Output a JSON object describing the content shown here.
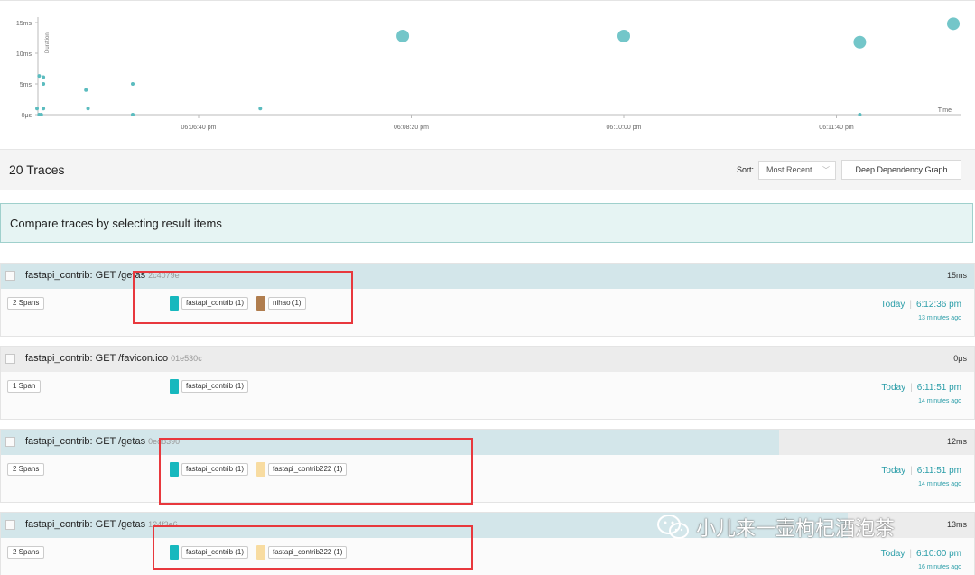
{
  "chart_data": {
    "type": "scatter",
    "y_ticks": [
      "15ms",
      "10ms",
      "5ms",
      "0μs"
    ],
    "y_tick_values": [
      15,
      10,
      5,
      0
    ],
    "ylabel": "Duration",
    "xlabel": "Time",
    "x_ticks": [
      "06:06:40 pm",
      "06:08:20 pm",
      "06:10:00 pm",
      "06:11:40 pm"
    ],
    "x_tick_seconds": [
      0,
      100,
      200,
      300
    ],
    "ylim": [
      0,
      16
    ],
    "series": [
      {
        "color": "#5bbcbf",
        "points": [
          {
            "t": -76,
            "d": 1,
            "r": 2
          },
          {
            "t": -75,
            "d": 0,
            "r": 2
          },
          {
            "t": -75,
            "d": 6.3,
            "r": 2
          },
          {
            "t": -74,
            "d": 0,
            "r": 2
          },
          {
            "t": -73,
            "d": 5,
            "r": 2
          },
          {
            "t": -73,
            "d": 6.1,
            "r": 2
          },
          {
            "t": -73,
            "d": 1,
            "r": 2
          },
          {
            "t": -53,
            "d": 4,
            "r": 2
          },
          {
            "t": -52,
            "d": 1,
            "r": 2
          },
          {
            "t": -31,
            "d": 5,
            "r": 2
          },
          {
            "t": -31,
            "d": 0,
            "r": 2
          },
          {
            "t": 29,
            "d": 1,
            "r": 2
          },
          {
            "t": 96,
            "d": 12.8,
            "r": 7
          },
          {
            "t": 200,
            "d": 12.8,
            "r": 7
          },
          {
            "t": 311,
            "d": 11.8,
            "r": 7
          },
          {
            "t": 311,
            "d": 0,
            "r": 2
          },
          {
            "t": 355,
            "d": 14.8,
            "r": 7
          }
        ]
      }
    ]
  },
  "header": {
    "traces_count": "20 Traces",
    "sort_label": "Sort:",
    "sort_value": "Most Recent",
    "ddg_button": "Deep Dependency Graph"
  },
  "compare_banner": "Compare traces by selecting result items",
  "traces": [
    {
      "name": "fastapi_contrib: GET /getas",
      "trace_id": "2c4079e",
      "duration": "15ms",
      "duration_fraction": 1.0,
      "spans": "2 Spans",
      "services": [
        {
          "label": "fastapi_contrib (1)",
          "color": "#17b8be"
        },
        {
          "label": "nihao (1)",
          "color": "#b07d4e"
        }
      ],
      "date": "Today",
      "time": "6:12:36 pm",
      "ago": "13 minutes ago"
    },
    {
      "name": "fastapi_contrib: GET /favicon.ico",
      "trace_id": "01e530c",
      "duration": "0μs",
      "duration_fraction": 0.0,
      "spans": "1 Span",
      "services": [
        {
          "label": "fastapi_contrib (1)",
          "color": "#17b8be"
        }
      ],
      "date": "Today",
      "time": "6:11:51 pm",
      "ago": "14 minutes ago"
    },
    {
      "name": "fastapi_contrib: GET /getas",
      "trace_id": "0ed8390",
      "duration": "12ms",
      "duration_fraction": 0.8,
      "spans": "2 Spans",
      "services": [
        {
          "label": "fastapi_contrib (1)",
          "color": "#17b8be"
        },
        {
          "label": "fastapi_contrib222 (1)",
          "color": "#f8dca1"
        }
      ],
      "date": "Today",
      "time": "6:11:51 pm",
      "ago": "14 minutes ago"
    },
    {
      "name": "fastapi_contrib: GET /getas",
      "trace_id": "124f3e6",
      "duration": "13ms",
      "duration_fraction": 0.87,
      "spans": "2 Spans",
      "services": [
        {
          "label": "fastapi_contrib (1)",
          "color": "#17b8be"
        },
        {
          "label": "fastapi_contrib222 (1)",
          "color": "#f8dca1"
        }
      ],
      "date": "Today",
      "time": "6:10:00 pm",
      "ago": "16 minutes ago"
    }
  ],
  "watermark": "小儿来一壶枸杞酒泡茶",
  "colors": {
    "accent": "#2a9da8",
    "annotation": "#e8383d",
    "banner_bg": "#e6f4f3"
  }
}
